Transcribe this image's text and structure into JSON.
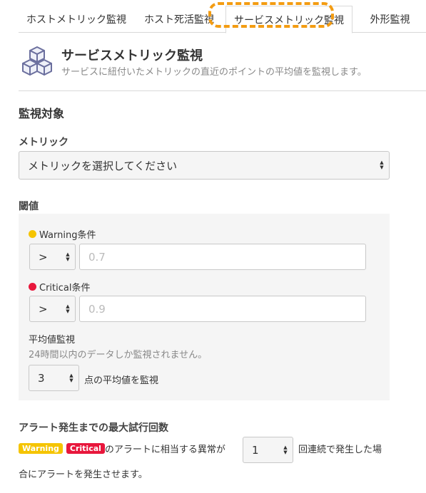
{
  "tabs": [
    {
      "label": "ホストメトリック監視"
    },
    {
      "label": "ホスト死活監視"
    },
    {
      "label": "サービスメトリック監視"
    },
    {
      "label": "外形監視"
    }
  ],
  "header": {
    "title": "サービスメトリック監視",
    "subtitle": "サービスに紐付いたメトリックの直近のポイントの平均値を監視します。",
    "icon": "cubes-icon"
  },
  "section": {
    "title": "監視対象"
  },
  "metric": {
    "label": "メトリック",
    "select_value": "メトリックを選択してください"
  },
  "threshold": {
    "label": "閾値",
    "warning": {
      "label": "Warning条件",
      "operator": ">",
      "placeholder": "0.7",
      "color": "#f5c400"
    },
    "critical": {
      "label": "Critical条件",
      "operator": ">",
      "placeholder": "0.9",
      "color": "#e8173c"
    },
    "average": {
      "title": "平均値監視",
      "note": "24時間以内のデータしか監視されません。",
      "points": "3",
      "suffix": "点の平均値を監視"
    }
  },
  "retry": {
    "label": "アラート発生までの最大試行回数",
    "warning_badge": "Warning",
    "critical_badge": "Critical",
    "text_before": "のアラートに相当する異常が",
    "count": "1",
    "text_after": "回連続で発生した場",
    "text_line2": "合にアラートを発生させます。",
    "warning_color": "#f5c400",
    "critical_color": "#e8173c"
  },
  "accent": {
    "highlight": "#f39c12"
  }
}
